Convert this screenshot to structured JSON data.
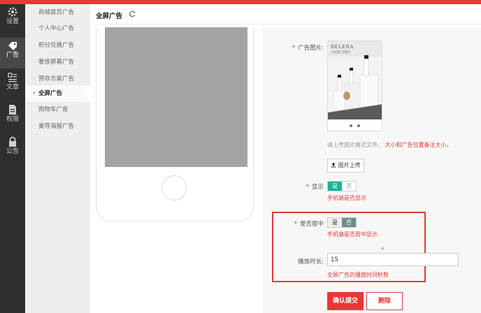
{
  "sidebar": {
    "items": [
      {
        "label": "设置",
        "icon": "gear-icon"
      },
      {
        "label": "广告",
        "icon": "tag-icon"
      },
      {
        "label": "文章",
        "icon": "article-icon"
      },
      {
        "label": "权限",
        "icon": "document-icon"
      },
      {
        "label": "公告",
        "icon": "lock-icon"
      }
    ],
    "active_index": 1
  },
  "submenu": {
    "items": [
      "商城首页广告",
      "个人中心广告",
      "积分兑换广告",
      "奢侈屏幕广告",
      "预存方案广告",
      "全屏广告",
      "购物车广告",
      "美导海报广告"
    ],
    "bullet": "·",
    "active_index": 5
  },
  "page": {
    "title": "全屏广告"
  },
  "form": {
    "image_label": "广告图片:",
    "image_caption_brand": "DELENA",
    "image_caption_sub": "小红瓶·万能水",
    "image_hint_prefix": "请上传图片格式文件。",
    "image_hint_emphasis": "大小和广告位置备注大小。",
    "upload_label": "图片上传",
    "show_label": "显示",
    "show_toggle": {
      "yes": "是",
      "no": "否",
      "selected": "yes"
    },
    "show_note": "手机端是否显示",
    "center_label": "是否居中",
    "center_toggle": {
      "yes": "是",
      "no": "否",
      "selected": "no"
    },
    "center_note": "手机端是否居中显示",
    "duration_label": "播放时长:",
    "duration_value": "15",
    "duration_note": "全屏广告的播放时间秒数",
    "submit_label": "确认提交",
    "delete_label": "删除",
    "required_mark": "*"
  },
  "colors": {
    "accent": "#e83737",
    "toggle_on": "#1bb394",
    "toggle_off_selected": "#6f8f88",
    "sidebar_bg": "#2f2f2f"
  }
}
